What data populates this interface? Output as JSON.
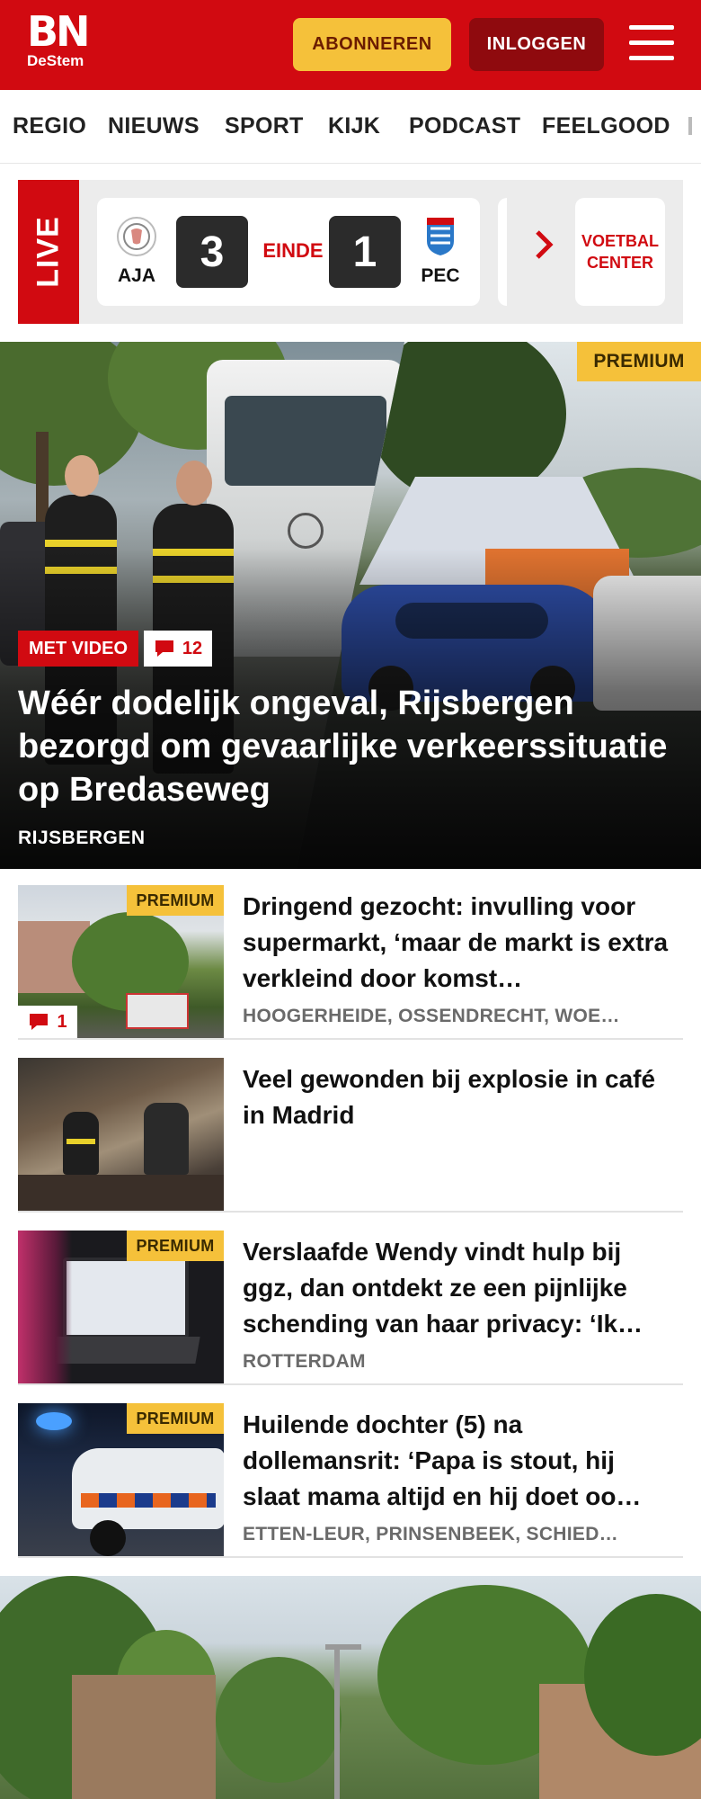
{
  "header": {
    "logo_main": "BN",
    "logo_sub": "DeStem",
    "subscribe_label": "ABONNEREN",
    "login_label": "INLOGGEN",
    "colors": {
      "brand": "#d10a11",
      "subscribe": "#f5c13a",
      "login": "#8f0a0e"
    }
  },
  "nav": {
    "items": [
      "REGIO",
      "NIEUWS",
      "SPORT",
      "KIJK",
      "PODCAST",
      "FEELGOOD"
    ]
  },
  "live": {
    "label": "LIVE",
    "home": {
      "name": "AJA",
      "score": "3"
    },
    "status": "EINDE",
    "away": {
      "name": "PEC",
      "score": "1"
    },
    "center_label": "VOETBAL CENTER"
  },
  "hero": {
    "premium": "PREMIUM",
    "video_tag": "MET VIDEO",
    "comments": "12",
    "title": "Wéér dodelijk ongeval, Rijsbergen bezorgd om gevaarlijke verkeerssitu­atie op Bredaseweg",
    "location": "RIJSBERGEN"
  },
  "articles": [
    {
      "premium": "PREMIUM",
      "title": "Dringend gezocht: invulling voor supermarkt, ‘maar de markt is extra verkleind door komst…",
      "location": "HOOGERHEIDE, OSSENDRECHT, WOE…",
      "comments": "1"
    },
    {
      "title": "Veel gewonden bij explosie in café in Madrid"
    },
    {
      "premium": "PREMIUM",
      "title": "Verslaafde Wendy vindt hulp bij ggz, dan ontdekt ze een pijnlijke schending van haar privacy: ‘Ik…",
      "location": "ROTTERDAM"
    },
    {
      "premium": "PREMIUM",
      "title": "Huilende dochter (5) na dollemansrit: ‘Papa is stout, hij slaat mama altijd en hij doet oo…",
      "location": "ETTEN-LEUR, PRINSENBEEK, SCHIED…"
    }
  ]
}
